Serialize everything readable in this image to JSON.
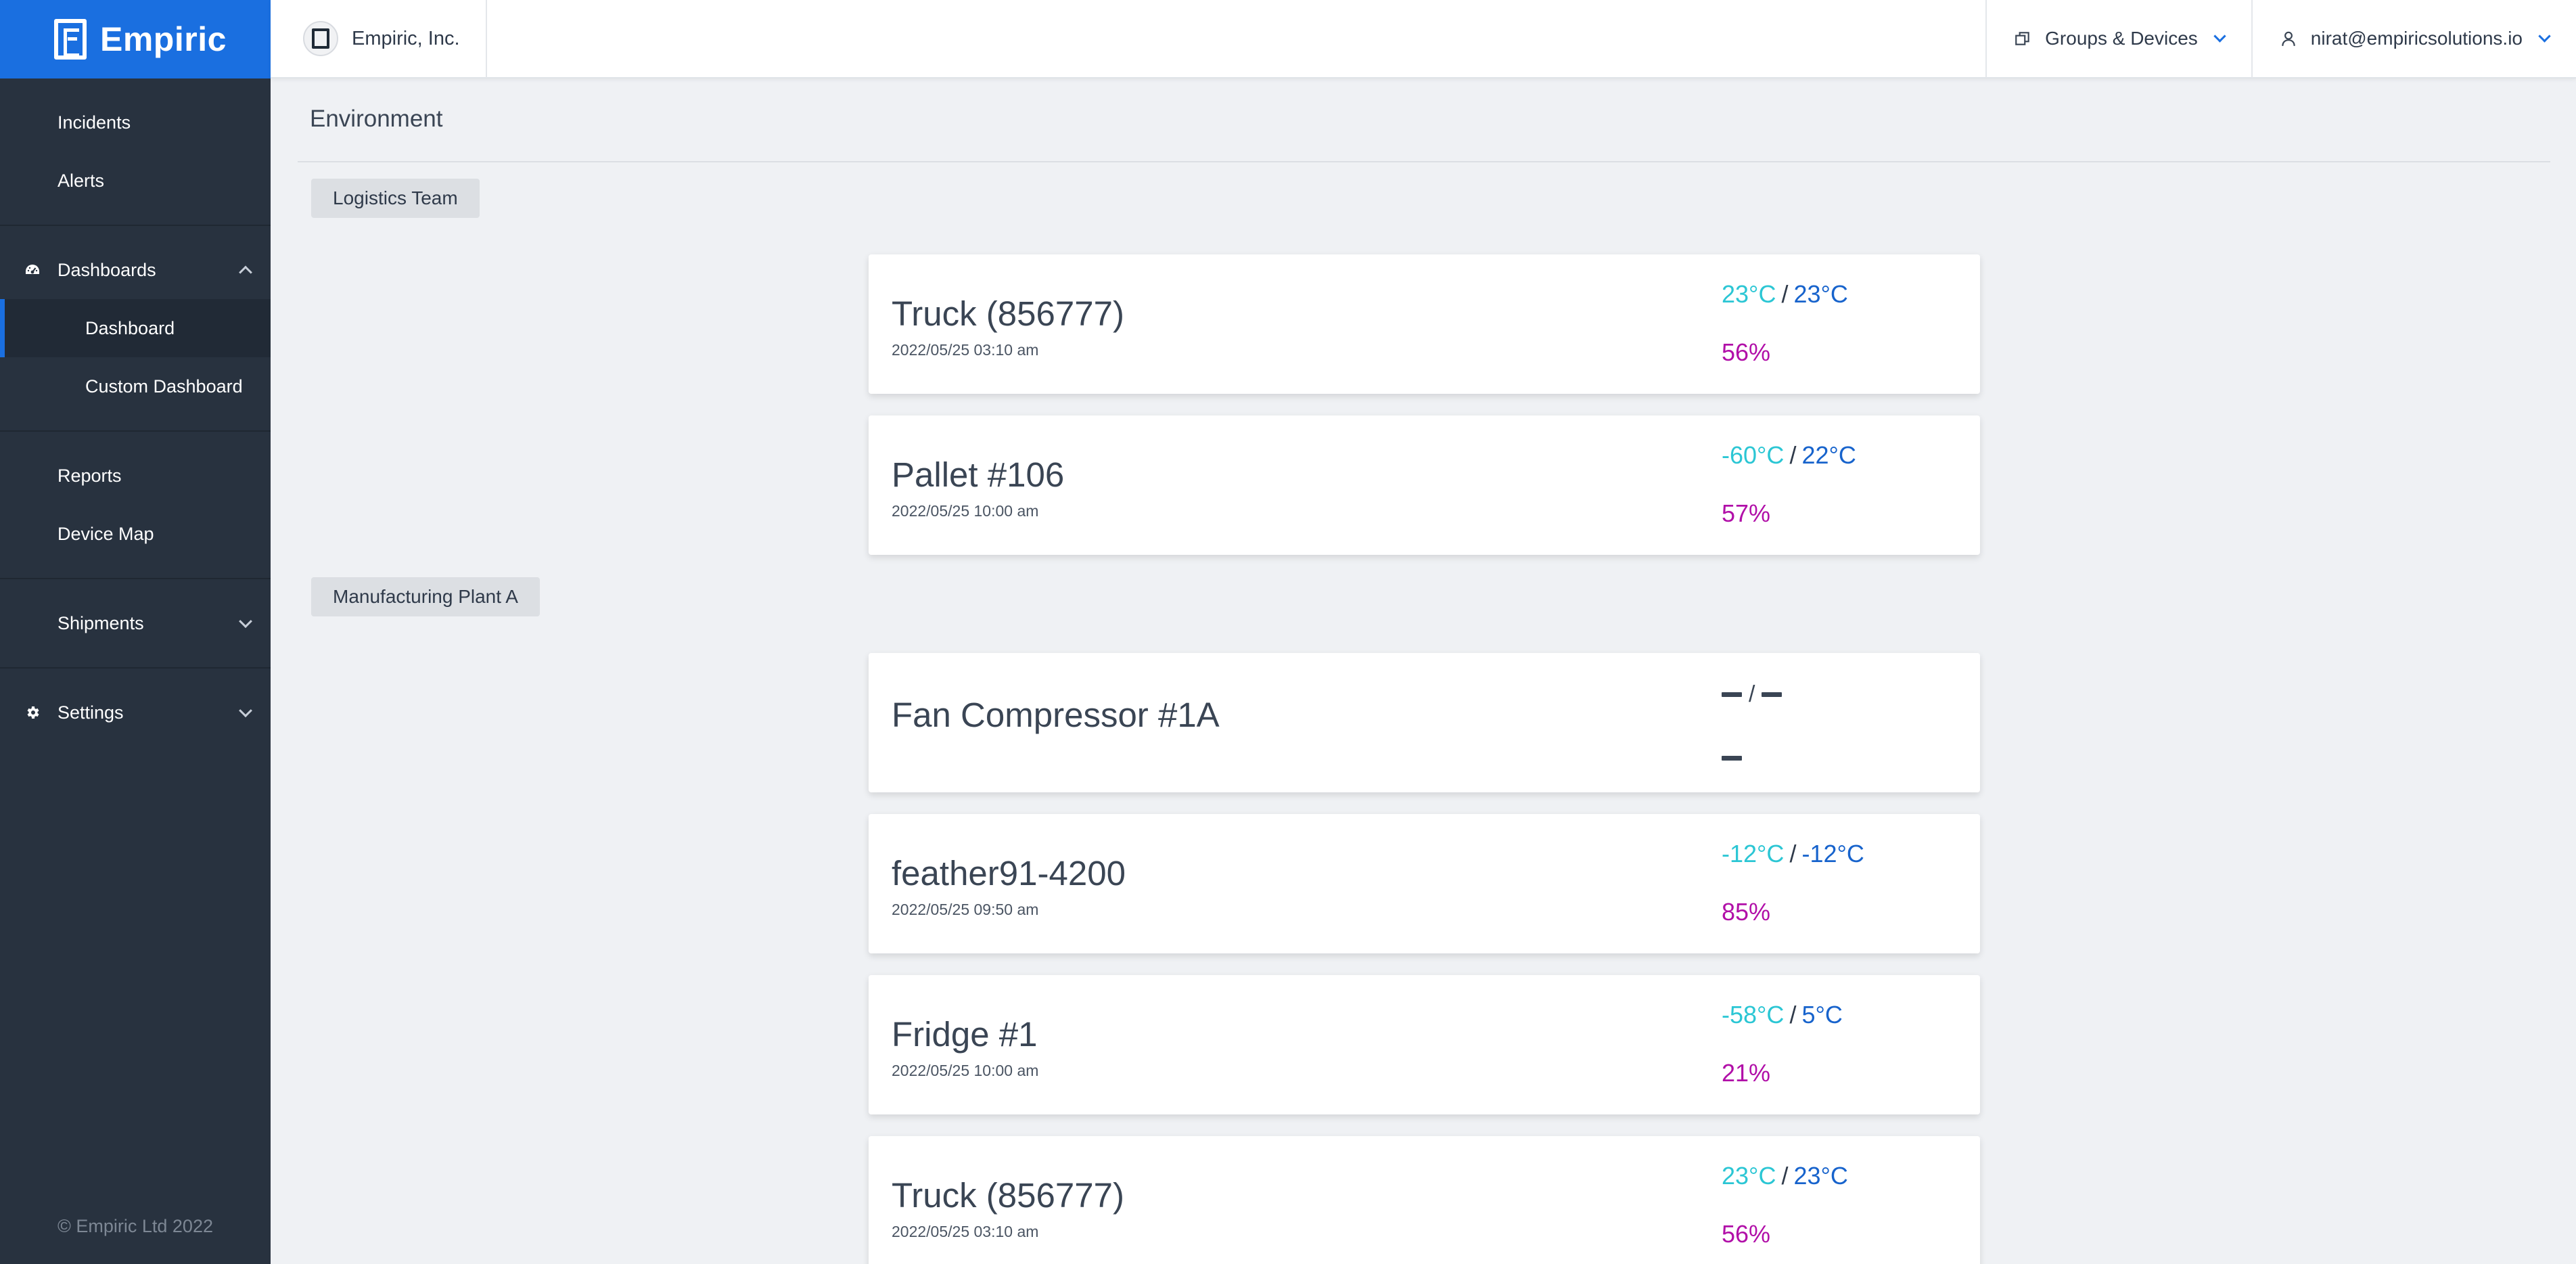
{
  "brand": {
    "name": "Empiric"
  },
  "topbar": {
    "org_name": "Empiric, Inc.",
    "groups_label": "Groups & Devices",
    "user_email": "nirat@empiricsolutions.io"
  },
  "sidebar": {
    "items": {
      "incidents": "Incidents",
      "alerts": "Alerts",
      "dashboards": "Dashboards",
      "dashboard": "Dashboard",
      "custom_dashboard": "Custom Dashboard",
      "reports": "Reports",
      "device_map": "Device Map",
      "shipments": "Shipments",
      "settings": "Settings"
    },
    "footer": "© Empiric Ltd 2022"
  },
  "page": {
    "title": "Environment"
  },
  "groups": [
    {
      "name": "Logistics Team",
      "devices": [
        {
          "name": "Truck (856777)",
          "time": "2022/05/25 03:10 am",
          "temp_min": "23°C",
          "separator": "/",
          "temp_max": "23°C",
          "humidity": "56%"
        },
        {
          "name": "Pallet #106",
          "time": "2022/05/25 10:00 am",
          "temp_min": "-60°C",
          "separator": "/",
          "temp_max": "22°C",
          "humidity": "57%"
        }
      ]
    },
    {
      "name": "Manufacturing Plant A",
      "devices": [
        {
          "name": "Fan Compressor #1A",
          "separator": "/"
        },
        {
          "name": "feather91-4200",
          "time": "2022/05/25 09:50 am",
          "temp_min": "-12°C",
          "separator": "/",
          "temp_max": "-12°C",
          "humidity": "85%"
        },
        {
          "name": "Fridge #1",
          "time": "2022/05/25 10:00 am",
          "temp_min": "-58°C",
          "separator": "/",
          "temp_max": "5°C",
          "humidity": "21%"
        },
        {
          "name": "Truck (856777)",
          "time": "2022/05/25 03:10 am",
          "temp_min": "23°C",
          "separator": "/",
          "temp_max": "23°C",
          "humidity": "56%"
        }
      ]
    }
  ],
  "colors": {
    "brand_blue": "#1a6fe0",
    "sidebar_bg": "#28323f",
    "temp_min": "#2bc6d4",
    "temp_max": "#1763cc",
    "humidity": "#b10fa8"
  }
}
